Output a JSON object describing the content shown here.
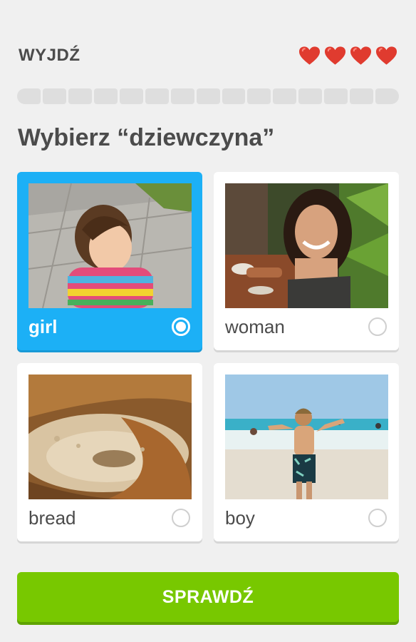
{
  "header": {
    "exit_label": "WYJDŹ",
    "hearts": 4,
    "heart_color": "#e03b2f"
  },
  "progress": {
    "segments": 15,
    "completed": 0,
    "track_color": "#dedede"
  },
  "prompt": {
    "text": "Wybierz “dziewczyna”"
  },
  "options": [
    {
      "label": "girl",
      "selected": true,
      "image": "toddler-girl-photo"
    },
    {
      "label": "woman",
      "selected": false,
      "image": "smiling-woman-photo"
    },
    {
      "label": "bread",
      "selected": false,
      "image": "bread-loaf-photo"
    },
    {
      "label": "boy",
      "selected": false,
      "image": "boy-on-beach-photo"
    }
  ],
  "colors": {
    "selected": "#1cb0f6",
    "check_button": "#78c800"
  },
  "check_button": {
    "label": "SPRAWDŹ"
  }
}
